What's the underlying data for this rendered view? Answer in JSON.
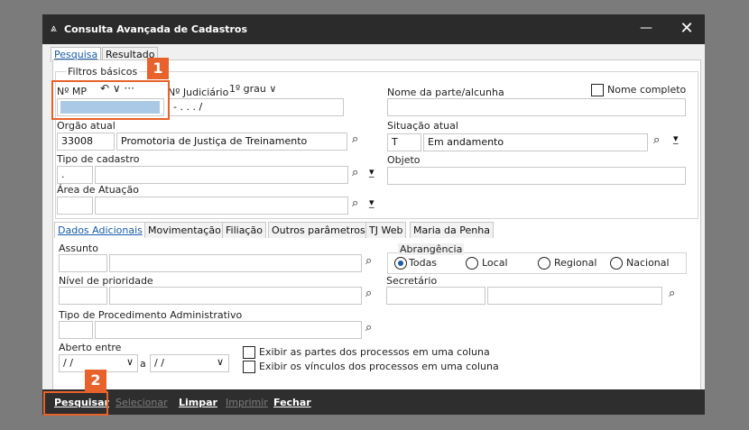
{
  "window": {
    "title": "Consulta Avançada de Cadastros",
    "minimize": "—",
    "close": "✕"
  },
  "tabs": [
    {
      "label": "Pesquisa"
    },
    {
      "label": "Resultado"
    }
  ],
  "filtros": {
    "group_title": "Filtros básicos",
    "nmp_label": "Nº MP",
    "nmp_tools": "↶ ∨ ···",
    "njud_label": "Nº Judiciário",
    "grau_select": "1º grau ∨",
    "njud_value": "-  .    .    .    /",
    "nome_label": "Nome da parte/alcunha",
    "nome_completo": "Nome completo",
    "orgao_label": "Orgão atual",
    "orgao_code": "33008",
    "orgao_name": "Promotoria de Justiça de Treinamento",
    "situacao_label": "Situação atual",
    "situacao_code": "T",
    "situacao_value": "Em andamento",
    "tipo_label": "Tipo de cadastro",
    "tipo_code": ".",
    "objeto_label": "Objeto",
    "area_label": "Área de Atuação"
  },
  "subtabs": [
    {
      "label": "Dados Adicionais"
    },
    {
      "label": "Movimentação"
    },
    {
      "label": "Filiação"
    },
    {
      "label": "Outros parâmetros"
    },
    {
      "label": "TJ Web"
    },
    {
      "label": "Maria da Penha"
    }
  ],
  "adicionais": {
    "assunto_label": "Assunto",
    "abrangencia_label": "Abrangência",
    "radios": [
      {
        "label": "Todas"
      },
      {
        "label": "Local"
      },
      {
        "label": "Regional"
      },
      {
        "label": "Nacional"
      }
    ],
    "nivel_label": "Nível de prioridade",
    "secretario_label": "Secretário",
    "tipo_proc_label": "Tipo de Procedimento Administrativo",
    "aberto_label": "Aberto entre",
    "date_from": "/ /",
    "date_sep": "a",
    "date_to": "/ /",
    "check1": "Exibir as partes dos processos em uma coluna",
    "check2": "Exibir os vínculos dos processos em uma coluna"
  },
  "footer": {
    "pesquisar": "Pesquisar",
    "selecionar": "Selecionar",
    "limpar": "Limpar",
    "imprimir": "Imprimir",
    "fechar": "Fechar"
  },
  "callouts": {
    "one": "1",
    "two": "2"
  },
  "colors": {
    "accent": "#e8622b",
    "titlebar": "#2b2b2b",
    "link": "#1a5ca8"
  },
  "icons": {
    "search": "search-icon",
    "dropdown": "chevron-down-icon",
    "select": "selection-icon"
  }
}
